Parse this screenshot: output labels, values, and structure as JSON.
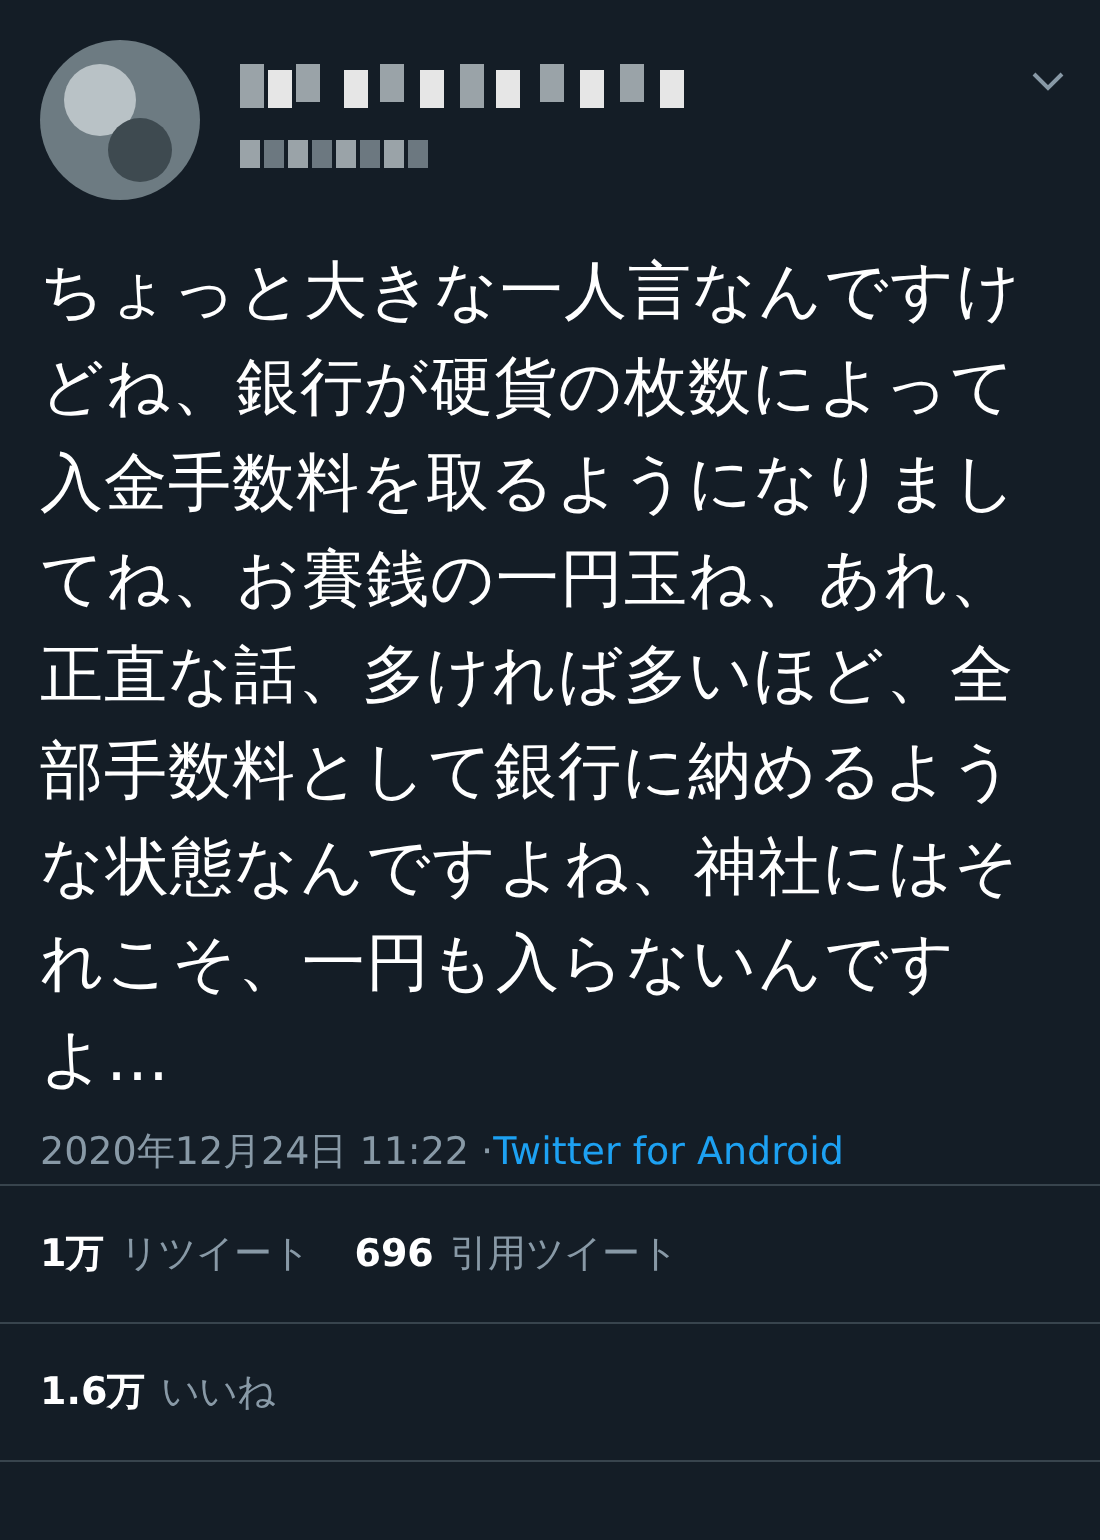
{
  "tweet": {
    "text": "ちょっと大きな一人言なんですけどね、銀行が硬貨の枚数によって入金手数料を取るようになりましてね、お賽銭の一円玉ね、あれ、正直な話、多ければ多いほど、全部手数料として銀行に納めるような状態なんですよね、神社にはそれこそ、一円も入らないんですよ…",
    "timestamp": "2020年12月24日 11:22 · ",
    "source": "Twitter for Android"
  },
  "stat_rows": [
    {
      "items": [
        {
          "count": "1万",
          "label": "リツイート"
        },
        {
          "count": "696",
          "label": "引用ツイート"
        }
      ]
    },
    {
      "items": [
        {
          "count": "1.6万",
          "label": "いいね"
        }
      ]
    }
  ]
}
